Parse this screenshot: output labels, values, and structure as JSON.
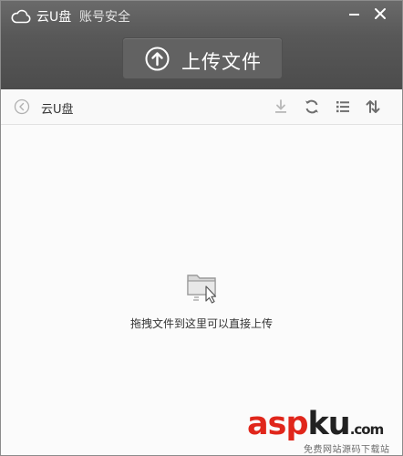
{
  "titlebar": {
    "app_title": "云U盘",
    "account_link": "账号安全"
  },
  "upload": {
    "label": "上传文件"
  },
  "toolbar": {
    "breadcrumb": "云U盘"
  },
  "content": {
    "drop_hint": "拖拽文件到这里可以直接上传"
  },
  "watermark": {
    "brand_part1": "asp",
    "brand_part2": "ku",
    "brand_suffix": ".com",
    "tagline": "免费网站源码下载站",
    "color_red": "#e0261b",
    "color_black": "#222222"
  },
  "colors": {
    "header": "#5a5a5a",
    "upload_button": "#626262",
    "toolbar_icons": "#6e6e6e",
    "toolbar_icons_disabled": "#b8b8b8"
  }
}
